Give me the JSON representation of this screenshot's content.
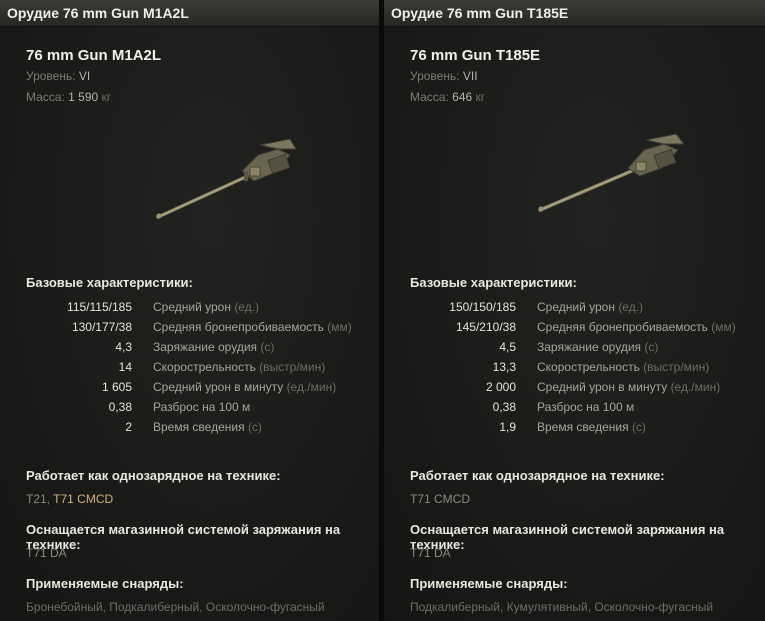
{
  "panels": [
    {
      "header": "Орудие 76 mm Gun M1A2L",
      "name": "76 mm Gun M1A2L",
      "level_label": "Уровень:",
      "level": "VI",
      "mass_label": "Масса:",
      "mass": "1 590",
      "mass_unit": "кг",
      "base_title": "Базовые характеристики:",
      "stats": [
        {
          "value": "115/115/185",
          "label": "Средний урон",
          "unit": "(ед.)"
        },
        {
          "value": "130/177/38",
          "label": "Средняя бронепробиваемость",
          "unit": "(мм)"
        },
        {
          "value": "4,3",
          "label": "Заряжание орудия",
          "unit": "(с)"
        },
        {
          "value": "14",
          "label": "Скорострельность",
          "unit": "(выстр/мин)"
        },
        {
          "value": "1 605",
          "label": "Средний урон в минуту",
          "unit": "(ед./мин)"
        },
        {
          "value": "0,38",
          "label": "Разброс на 100 м",
          "unit": ""
        },
        {
          "value": "2",
          "label": "Время сведения",
          "unit": "(с)"
        }
      ],
      "single_title": "Работает как однозарядное на технике:",
      "single_vehicles": "T21,",
      "single_vehicles_hl": "T71 CMCD",
      "magazine_title": "Оснащается магазинной системой заряжания на технике:",
      "magazine_vehicles": "T71 DA",
      "shells_title": "Применяемые снаряды:",
      "shells": "Бронебойный, Подкалиберный, Осколочно-фугасный"
    },
    {
      "header": "Орудие 76 mm Gun T185E",
      "name": "76 mm Gun T185E",
      "level_label": "Уровень:",
      "level": "VII",
      "mass_label": "Масса:",
      "mass": "646",
      "mass_unit": "кг",
      "base_title": "Базовые характеристики:",
      "stats": [
        {
          "value": "150/150/185",
          "label": "Средний урон",
          "unit": "(ед.)"
        },
        {
          "value": "145/210/38",
          "label": "Средняя бронепробиваемость",
          "unit": "(мм)"
        },
        {
          "value": "4,5",
          "label": "Заряжание орудия",
          "unit": "(с)"
        },
        {
          "value": "13,3",
          "label": "Скорострельность",
          "unit": "(выстр/мин)"
        },
        {
          "value": "2 000",
          "label": "Средний урон в минуту",
          "unit": "(ед./мин)"
        },
        {
          "value": "0,38",
          "label": "Разброс на 100 м",
          "unit": ""
        },
        {
          "value": "1,9",
          "label": "Время сведения",
          "unit": "(с)"
        }
      ],
      "single_title": "Работает как однозарядное на технике:",
      "single_vehicles": "T71 CMCD",
      "single_vehicles_hl": "",
      "magazine_title": "Оснащается магазинной системой заряжания на технике:",
      "magazine_vehicles": "T71 DA",
      "shells_title": "Применяемые снаряды:",
      "shells": "Подкалиберный, Кумулятивный, Осколочно-фугасный"
    }
  ]
}
